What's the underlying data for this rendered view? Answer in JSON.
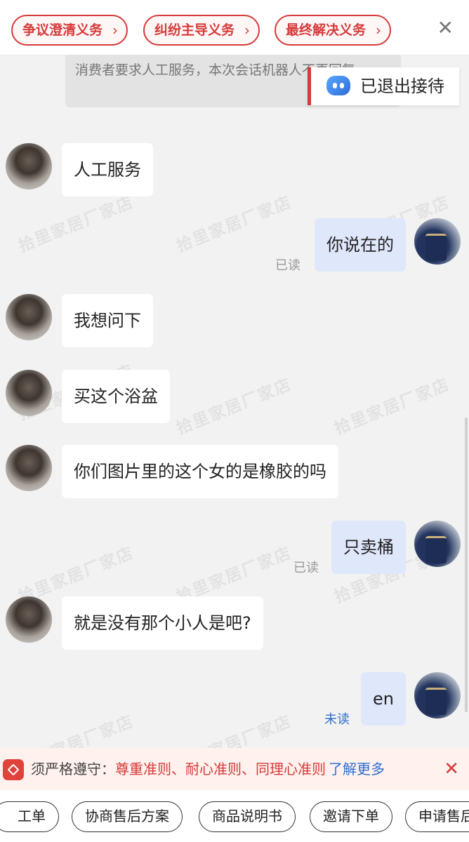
{
  "top_pills": [
    {
      "label": "争议澄清义务"
    },
    {
      "label": "纠纷主导义务"
    },
    {
      "label": "最终解决义务"
    }
  ],
  "icons": {
    "chevron": "chevron-right-icon",
    "close": "close-icon",
    "robot": "robot-icon",
    "rules": "shop-logo-icon"
  },
  "watermark": "拾里家居厂家店",
  "system_notice": "消费者要求人工服务，本次会话机器人不再回复",
  "robot_status": "已退出接待",
  "messages": [
    {
      "side": "left",
      "text": "人工服务"
    },
    {
      "side": "right",
      "text": "你说在的",
      "status": "已读"
    },
    {
      "side": "left",
      "text": "我想问下"
    },
    {
      "side": "left",
      "text": "买这个浴盆"
    },
    {
      "side": "left",
      "text": "你们图片里的这个女的是橡胶的吗"
    },
    {
      "side": "right",
      "text": "只卖桶",
      "status": "已读"
    },
    {
      "side": "left",
      "text": "就是没有那个小人是吧?"
    },
    {
      "side": "right",
      "text": "en",
      "status": "未读"
    }
  ],
  "rules_bar": {
    "prefix": "须严格遵守：",
    "rules": "尊重准则、耐心准则、同理心准则",
    "link": "了解更多"
  },
  "quick_buttons": [
    {
      "label": "工单"
    },
    {
      "label": "协商售后方案"
    },
    {
      "label": "商品说明书"
    },
    {
      "label": "邀请下单"
    },
    {
      "label": "申请售后"
    }
  ],
  "colors": {
    "accent": "#d63a3a",
    "link": "#2f6fd0",
    "bubble_out": "#dfe7fb",
    "background": "#f2f2f2"
  }
}
